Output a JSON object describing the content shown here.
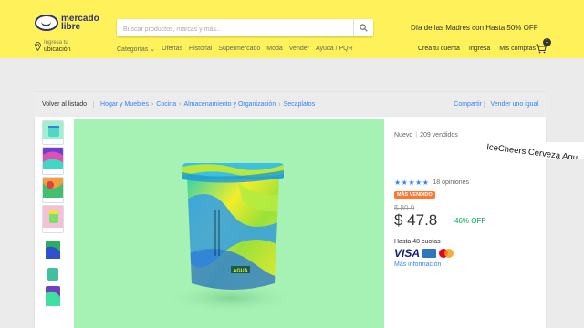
{
  "header": {
    "logo_text": "mercado libre",
    "search_placeholder": "Buscar productos, marcas y más...",
    "promo": "Día de las Madres con Hasta 50% OFF",
    "location_line1": "Ingresa tu",
    "location_line2": "ubicación",
    "nav": [
      "Categorías",
      "Ofertas",
      "Historial",
      "Supermercado",
      "Moda",
      "Vender",
      "Ayuda / PQR"
    ],
    "user_links": [
      "Crea tu cuenta",
      "Ingresa",
      "Mis compras"
    ],
    "cart_count": "1"
  },
  "breadcrumb": {
    "back": "Volver al listado",
    "items": [
      "Hogar y Muebles",
      "Cocina",
      "Almacenamiento y Organización",
      "Secaplatos"
    ],
    "separator": "›",
    "share": "Compartir",
    "sell_similar": "Vender uno igual"
  },
  "product": {
    "condition": "Nuevo",
    "sold": "209 vendidos",
    "title": "IceCheers Cerveza Agu",
    "stars": "★★★★★",
    "reviews": "18 opiniones",
    "badge": "MÁS VENDIDO",
    "old_price": "$ 89.9",
    "price": "$ 47.8",
    "discount": "46% OFF",
    "installments": "Hasta 48 cuotas",
    "card_brand": "VISA",
    "more_info": "Más información",
    "package_text": "AGUA"
  },
  "colors": {
    "header_bg": "#fff159",
    "link": "#3483fa",
    "discount": "#00a650",
    "badge": "#ff7733",
    "image_bg": "#a6f2b4"
  }
}
